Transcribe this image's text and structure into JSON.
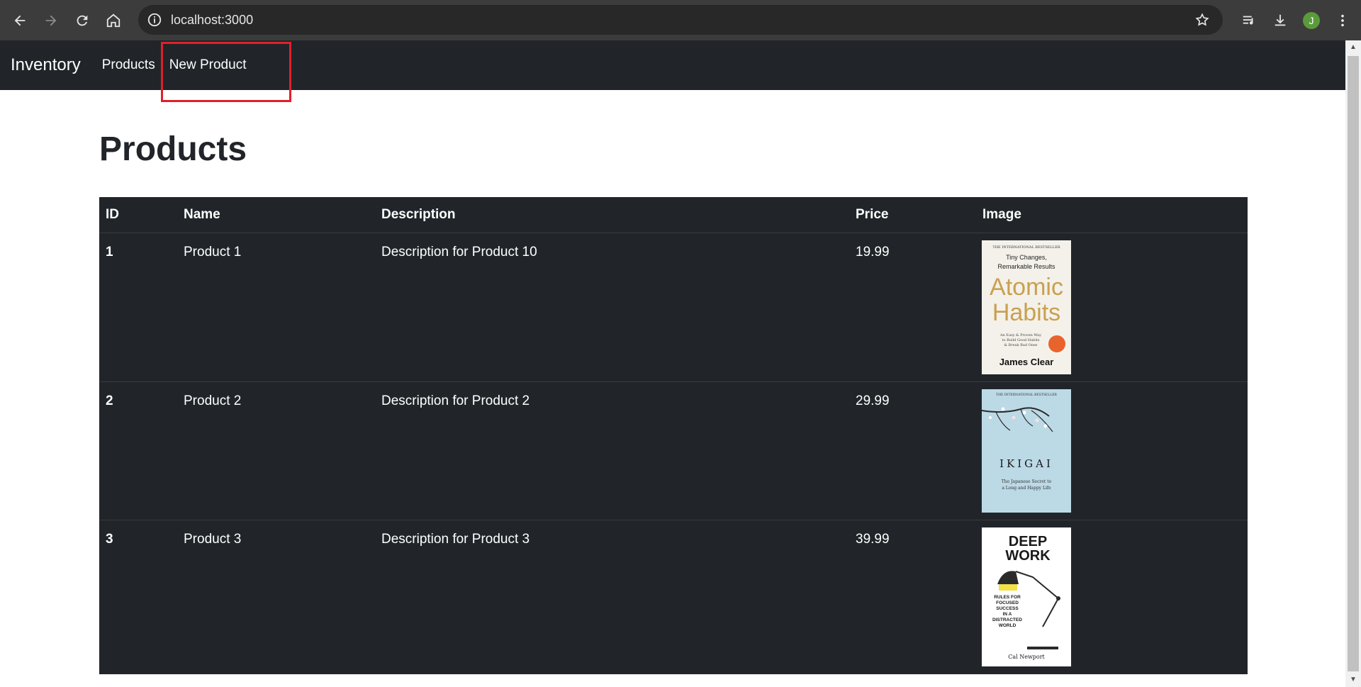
{
  "browser": {
    "url": "localhost:3000",
    "profile_initial": "J",
    "colors": {
      "chrome_bg": "#3c3c3c",
      "omnibox_bg": "#282828",
      "avatar": "#5b9a3c"
    }
  },
  "navbar": {
    "brand": "Inventory",
    "links": [
      {
        "label": "Products"
      },
      {
        "label": "New Product"
      }
    ],
    "colors": {
      "bg": "#212529",
      "highlight": "#e0202a"
    }
  },
  "page": {
    "title": "Products"
  },
  "table": {
    "headers": [
      "ID",
      "Name",
      "Description",
      "Price",
      "Image"
    ],
    "rows": [
      {
        "id": "1",
        "name": "Product 1",
        "description": "Description for Product 10",
        "price": "19.99",
        "image": {
          "top": "THE INTERNATIONAL BESTSELLER",
          "line1": "Tiny Changes,",
          "line2": "Remarkable Results",
          "title1": "Atomic",
          "title2": "Habits",
          "sub1": "An Easy & Proven Way",
          "sub2": "to Build Good Habits",
          "sub3": "& Break Bad Ones",
          "author": "James Clear"
        }
      },
      {
        "id": "2",
        "name": "Product 2",
        "description": "Description for Product 2",
        "price": "29.99",
        "image": {
          "top": "THE INTERNATIONAL BESTSELLER",
          "title": "IKIGAI",
          "sub1": "The Japanese Secret to",
          "sub2": "a Long and Happy Life"
        }
      },
      {
        "id": "3",
        "name": "Product 3",
        "description": "Description for Product 3",
        "price": "39.99",
        "image": {
          "title1": "DEEP",
          "title2": "WORK",
          "sub1": "RULES FOR",
          "sub2": "FOCUSED",
          "sub3": "SUCCESS",
          "sub4": "IN A",
          "sub5": "DISTRACTED",
          "sub6": "WORLD",
          "author": "Cal Newport"
        }
      }
    ]
  }
}
